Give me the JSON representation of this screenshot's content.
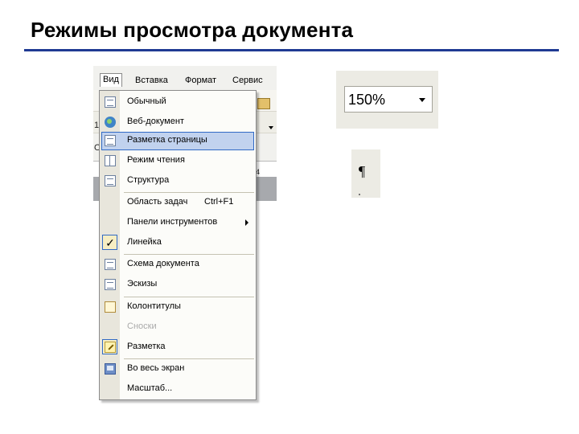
{
  "slide": {
    "title": "Режимы просмотра документа"
  },
  "menubar": {
    "items": [
      "Вид",
      "Вставка",
      "Формат",
      "Сервис"
    ],
    "active_index": 0
  },
  "background_fragments": {
    "left_digit": "1",
    "left_char": "О",
    "ruler_num": "4"
  },
  "view_menu": {
    "items": [
      {
        "label": "Обычный",
        "icon": "normal-view-icon"
      },
      {
        "label": "Веб-документ",
        "icon": "web-layout-icon"
      },
      {
        "label": "Разметка страницы",
        "icon": "page-layout-icon",
        "highlighted": true
      },
      {
        "label": "Режим чтения",
        "icon": "reading-mode-icon"
      },
      {
        "label": "Структура",
        "icon": "outline-icon"
      },
      {
        "label": "Область задач",
        "shortcut": "Ctrl+F1"
      },
      {
        "label": "Панели инструментов",
        "submenu": true
      },
      {
        "label": "Линейка",
        "icon": "checkmark-icon",
        "checked": true
      },
      {
        "label": "Схема документа",
        "icon": "document-map-icon"
      },
      {
        "label": "Эскизы",
        "icon": "thumbnails-icon"
      },
      {
        "label": "Колонтитулы",
        "icon": "header-footer-icon"
      },
      {
        "label": "Сноски",
        "disabled": true
      },
      {
        "label": "Разметка",
        "icon": "markup-icon"
      },
      {
        "label": "Во весь экран",
        "icon": "full-screen-icon"
      },
      {
        "label": "Масштаб..."
      }
    ]
  },
  "zoom": {
    "value": "150%"
  },
  "formatting_marks": {
    "symbol": "¶"
  },
  "colors": {
    "title_rule": "#1f3a93",
    "highlight": "#c1d2ee",
    "highlight_border": "#316ac5"
  }
}
